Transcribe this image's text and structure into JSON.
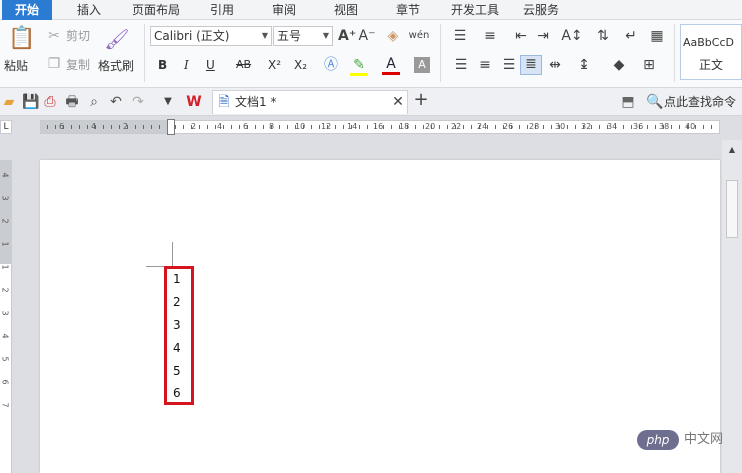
{
  "tabs": [
    "开始",
    "插入",
    "页面布局",
    "引用",
    "审阅",
    "视图",
    "章节",
    "开发工具",
    "云服务"
  ],
  "clipboard": {
    "paste": "粘贴",
    "cut": "剪切",
    "copy": "复制",
    "format_painter": "格式刷"
  },
  "font": {
    "name": "Calibri (正文)",
    "size": "五号",
    "bold": "B",
    "italic": "I",
    "underline": "U",
    "strike": "AB",
    "superscript": "X²",
    "subscript": "X₂"
  },
  "styles": {
    "preview": "AaBbCcD",
    "name": "正文"
  },
  "quickbar": {
    "doc_tab": "文档1 *",
    "search": "点此查找命令",
    "wps_logo": "W"
  },
  "ruler": {
    "h_numbers": [
      "6",
      "4",
      "2",
      "2",
      "4",
      "6",
      "8",
      "10",
      "12",
      "14",
      "16",
      "18",
      "20",
      "22",
      "24",
      "26",
      "28",
      "30",
      "32",
      "34",
      "36",
      "38",
      "40"
    ],
    "v_numbers": [
      "4",
      "3",
      "2",
      "1",
      "1",
      "2",
      "3",
      "4",
      "5",
      "6",
      "7"
    ]
  },
  "document": {
    "list_items": [
      "1",
      "2",
      "3",
      "4",
      "5",
      "6"
    ]
  },
  "watermark": {
    "logo": "php",
    "text": "中文网"
  },
  "colors": {
    "accent_tab": "#2b7bd3",
    "highlight_border": "#d6141e"
  }
}
